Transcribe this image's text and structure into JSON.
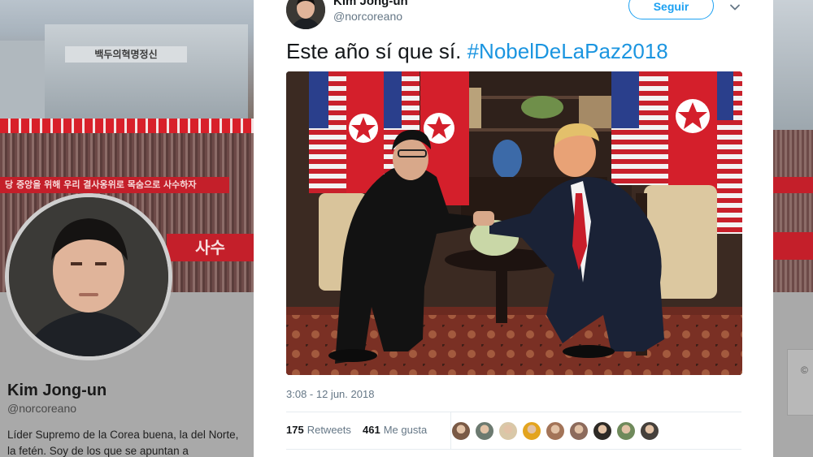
{
  "background": {
    "header_banner_top": "백두의혁명정신",
    "header_banner_middle": "당 중앙을 위해 우리 결사옹위로 목숨으로 사수하자",
    "header_banner_large": "사수",
    "profile": {
      "name": "Kim Jong-un",
      "handle": "@norcoreano",
      "bio": "Líder Supremo de la Corea buena, la del Norte, la fetén. Soy de los que se apuntan a"
    }
  },
  "tweet": {
    "author_name": "Kim Jong-un",
    "author_handle": "@norcoreano",
    "follow_label": "Seguir",
    "text_prefix": "Este año sí que sí. ",
    "hashtag": "#NobelDeLaPaz2018",
    "timestamp": "3:08 - 12 jun. 2018",
    "retweets_count": "175",
    "retweets_label": "Retweets",
    "likes_count": "461",
    "likes_label": "Me gusta"
  },
  "likers": [
    {
      "name": "liker-1",
      "color": "#7a5a46"
    },
    {
      "name": "liker-2",
      "color": "#6c7a70"
    },
    {
      "name": "liker-3",
      "color": "#d9c8a8"
    },
    {
      "name": "liker-4",
      "color": "#e3a41f"
    },
    {
      "name": "liker-5",
      "color": "#a37458"
    },
    {
      "name": "liker-6",
      "color": "#8d6b5c"
    },
    {
      "name": "liker-7",
      "color": "#2d2a26"
    },
    {
      "name": "liker-8",
      "color": "#6f8a5b"
    },
    {
      "name": "liker-9",
      "color": "#45403b"
    }
  ],
  "colors": {
    "accent": "#1da1f2",
    "hashtag": "#1b95e0",
    "secondary_text": "#657786"
  },
  "icons": {
    "menu": "chevron-down-icon"
  }
}
